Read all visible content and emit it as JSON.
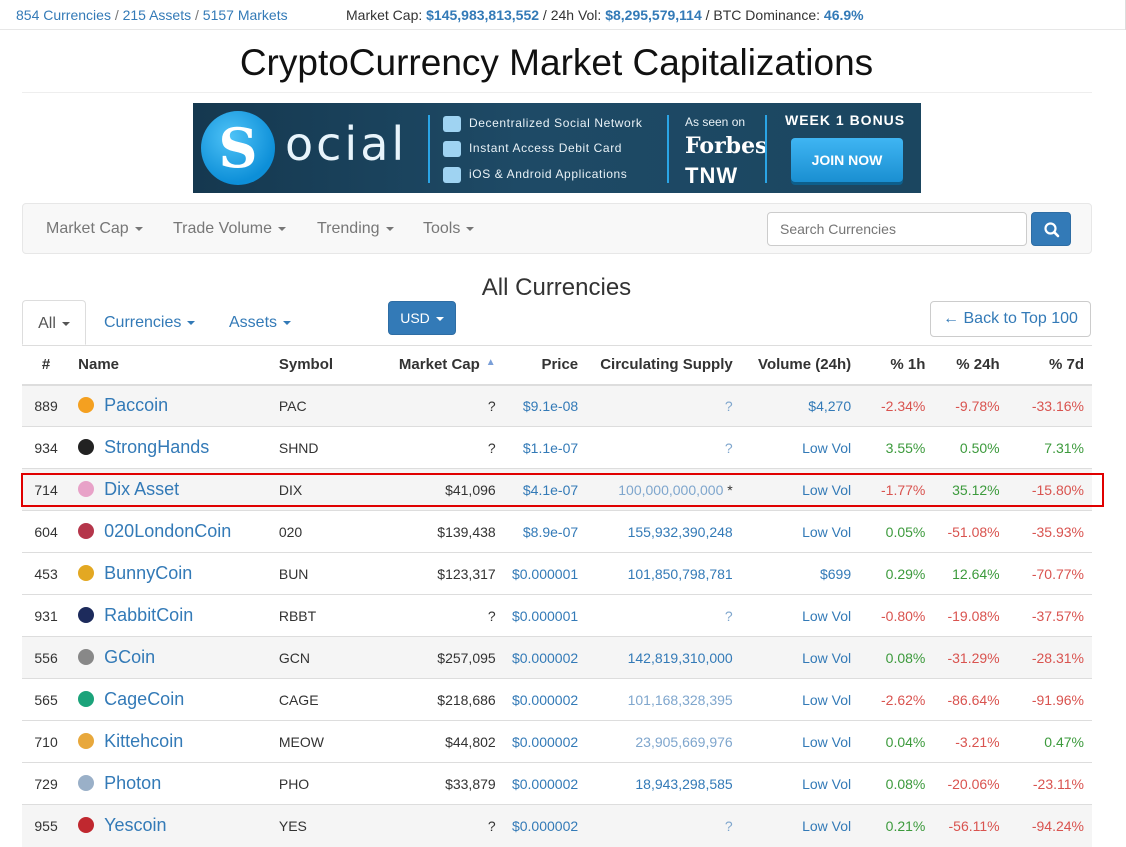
{
  "topbar": {
    "currencies": "854 Currencies",
    "assets": "215 Assets",
    "markets": "5157 Markets",
    "market_cap_label": "Market Cap:",
    "market_cap_value": "$145,983,813,552",
    "vol_label": "/ 24h Vol:",
    "vol_value": "$8,295,579,114",
    "dominance_label": "/ BTC Dominance:",
    "dominance_value": "46.9%",
    "sep": "/"
  },
  "title": "CryptoCurrency Market Capitalizations",
  "banner": {
    "logo_letter": "S",
    "wordmark": "ocial",
    "feature_1": "Decentralized Social Network",
    "feature_2": "Instant Access Debit Card",
    "feature_3": "iOS & Android Applications",
    "as_seen": "As seen on",
    "forbes": "Forbes",
    "tnw": "TNW",
    "bonus": "WEEK 1 BONUS",
    "join": "JOIN NOW"
  },
  "nav": {
    "market_cap": "Market Cap",
    "trade_volume": "Trade Volume",
    "trending": "Trending",
    "tools": "Tools",
    "search_placeholder": "Search Currencies"
  },
  "section_title": "All Currencies",
  "tabs": {
    "all": "All",
    "currencies": "Currencies",
    "assets": "Assets"
  },
  "usd_label": "USD",
  "back_label": "← Back to Top 100",
  "table": {
    "headers": {
      "rank": "#",
      "name": "Name",
      "symbol": "Symbol",
      "market_cap": "Market Cap",
      "sort_indicator": "▲",
      "price": "Price",
      "supply": "Circulating Supply",
      "volume": "Volume (24h)",
      "h1": "% 1h",
      "h24": "% 24h",
      "d7": "% 7d"
    },
    "rows": [
      {
        "rank": "889",
        "name": "Paccoin",
        "symbol": "PAC",
        "market_cap": "?",
        "price": "$9.1e-08",
        "supply": "?",
        "volume": "$4,270",
        "h1": "-2.34%",
        "h24": "-9.78%",
        "d7": "-33.16%",
        "icon_color": "#f4a020"
      },
      {
        "rank": "934",
        "name": "StrongHands",
        "symbol": "SHND",
        "market_cap": "?",
        "price": "$1.1e-07",
        "supply": "?",
        "volume": "Low Vol",
        "h1": "3.55%",
        "h24": "0.50%",
        "d7": "7.31%",
        "icon_color": "#222222"
      },
      {
        "rank": "714",
        "name": "Dix Asset",
        "symbol": "DIX",
        "market_cap": "$41,096",
        "price": "$4.1e-07",
        "supply": "100,000,000,000",
        "supply_note": " *",
        "volume": "Low Vol",
        "h1": "-1.77%",
        "h24": "35.12%",
        "d7": "-15.80%",
        "icon_color": "#e8a2c8"
      },
      {
        "rank": "604",
        "name": "020LondonCoin",
        "symbol": "020",
        "market_cap": "$139,438",
        "price": "$8.9e-07",
        "supply": "155,932,390,248",
        "volume": "Low Vol",
        "h1": "0.05%",
        "h24": "-51.08%",
        "d7": "-35.93%",
        "icon_color": "#b5364b"
      },
      {
        "rank": "453",
        "name": "BunnyCoin",
        "symbol": "BUN",
        "market_cap": "$123,317",
        "price": "$0.000001",
        "supply": "101,850,798,781",
        "volume": "$699",
        "h1": "0.29%",
        "h24": "12.64%",
        "d7": "-70.77%",
        "icon_color": "#e3a822"
      },
      {
        "rank": "931",
        "name": "RabbitCoin",
        "symbol": "RBBT",
        "market_cap": "?",
        "price": "$0.000001",
        "supply": "?",
        "volume": "Low Vol",
        "h1": "-0.80%",
        "h24": "-19.08%",
        "d7": "-37.57%",
        "icon_color": "#1d2b5c"
      },
      {
        "rank": "556",
        "name": "GCoin",
        "symbol": "GCN",
        "market_cap": "$257,095",
        "price": "$0.000002",
        "supply": "142,819,310,000",
        "volume": "Low Vol",
        "h1": "0.08%",
        "h24": "-31.29%",
        "d7": "-28.31%",
        "icon_color": "#888888"
      },
      {
        "rank": "565",
        "name": "CageCoin",
        "symbol": "CAGE",
        "market_cap": "$218,686",
        "price": "$0.000002",
        "supply": "101,168,328,395",
        "volume": "Low Vol",
        "h1": "-2.62%",
        "h24": "-86.64%",
        "d7": "-91.96%",
        "icon_color": "#1ba37a"
      },
      {
        "rank": "710",
        "name": "Kittehcoin",
        "symbol": "MEOW",
        "market_cap": "$44,802",
        "price": "$0.000002",
        "supply": "23,905,669,976",
        "volume": "Low Vol",
        "h1": "0.04%",
        "h24": "-3.21%",
        "d7": "0.47%",
        "icon_color": "#e8a83c"
      },
      {
        "rank": "729",
        "name": "Photon",
        "symbol": "PHO",
        "market_cap": "$33,879",
        "price": "$0.000002",
        "supply": "18,943,298,585",
        "volume": "Low Vol",
        "h1": "0.08%",
        "h24": "-20.06%",
        "d7": "-23.11%",
        "icon_color": "#9ab0c8"
      },
      {
        "rank": "955",
        "name": "Yescoin",
        "symbol": "YES",
        "market_cap": "?",
        "price": "$0.000002",
        "supply": "?",
        "volume": "Low Vol",
        "h1": "0.21%",
        "h24": "-56.11%",
        "d7": "-94.24%",
        "icon_color": "#c0282f"
      }
    ]
  }
}
